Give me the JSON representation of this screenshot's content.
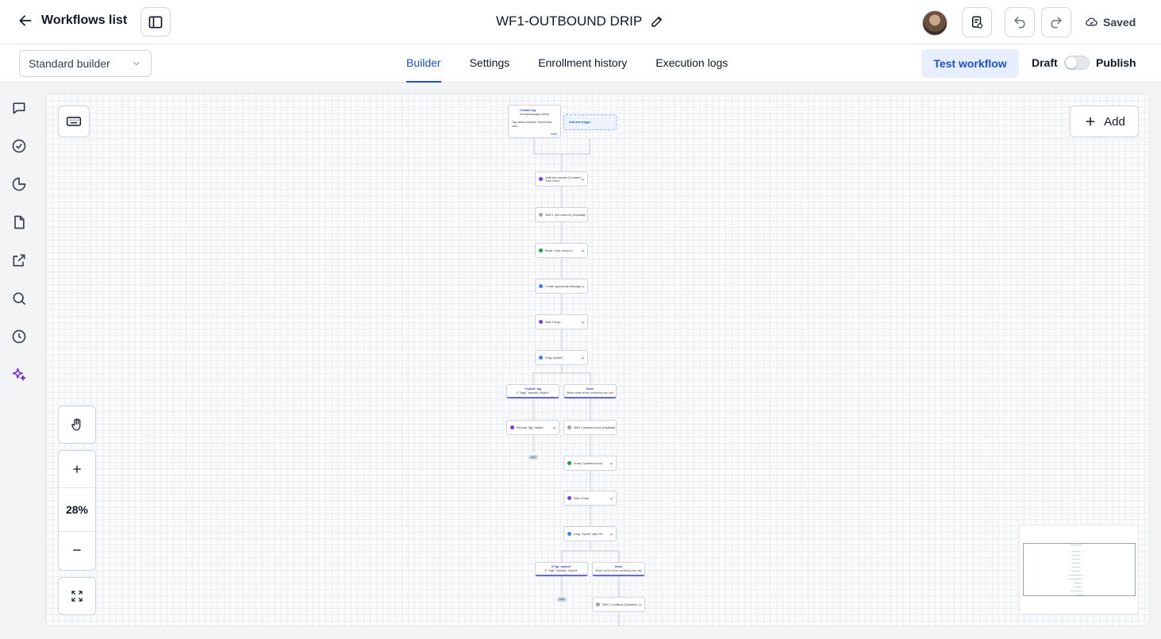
{
  "header": {
    "back_label": "Workflows list",
    "workflow_title": "WF1-OUTBOUND DRIP",
    "saved_label": "Saved"
  },
  "subbar": {
    "builder_mode": "Standard builder",
    "tabs": [
      {
        "label": "Builder",
        "active": true
      },
      {
        "label": "Settings",
        "active": false
      },
      {
        "label": "Enrollment history",
        "active": false
      },
      {
        "label": "Execution logs",
        "active": false
      }
    ],
    "test_label": "Test workflow",
    "draft_label": "Draft",
    "publish_label": "Publish",
    "published": false
  },
  "canvas": {
    "add_label": "Add",
    "zoom": "28%",
    "trigger": {
      "title": "Contact tag",
      "subtitle": "touch{campaign-name}",
      "detail": "Tag added includes \"touch-lead-cam...",
      "stats": "Stats"
    },
    "add_trigger_label": "Add new trigger",
    "nodes": [
      {
        "label": "Until time window (Contact's Time Zone)",
        "color": "#7c3aed"
      },
      {
        "label": "SMS 1 (the check in) (Disabled)",
        "color": "#9ca3af"
      },
      {
        "label": "Email 1 (the check in)",
        "color": "#16a34a"
      },
      {
        "label": "Create opportunity Message",
        "color": "#3b82f6"
      },
      {
        "label": "Wait 3 Days",
        "color": "#7c3aed"
      },
      {
        "label": "If tag \"replied\"",
        "color": "#3b82f6"
      },
      {
        "label": "Remove Tag \"replied\"",
        "color": "#7c3aed"
      },
      {
        "label": "SMS 2 (started touch) (Disabled)",
        "color": "#9ca3af"
      },
      {
        "label": "Email 2 (started touch)",
        "color": "#16a34a"
      },
      {
        "label": "Wait 4 Days",
        "color": "#7c3aed"
      },
      {
        "label": "If tag \"replied\" after M2",
        "color": "#3b82f6"
      },
      {
        "label": "SMS 3 (Untitled) (Disabled)",
        "color": "#9ca3af"
      }
    ],
    "branches": [
      {
        "title": "\"replied\" tag",
        "desc": "If \"Tags\" Includes \"replied\""
      },
      {
        "title": "None",
        "desc": "When none of the conditions are met"
      },
      {
        "title": "If Tag \"replied\"",
        "desc": "If \"Tags\" Includes \"replied\""
      },
      {
        "title": "None",
        "desc": "When none of the conditions are met"
      }
    ],
    "end_label": "END"
  },
  "colors": {
    "accent": "#1d4ed8",
    "accent_light": "#e7efff",
    "ai_icon": "#6d28d9"
  }
}
